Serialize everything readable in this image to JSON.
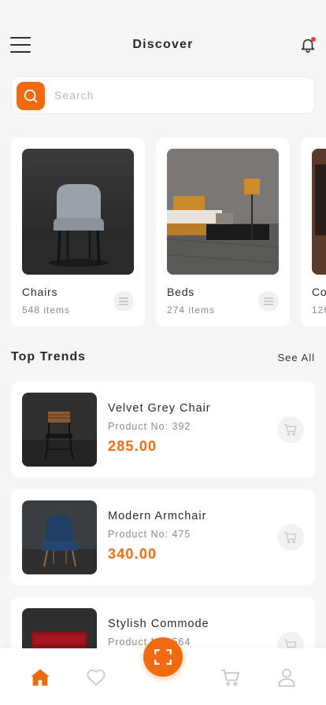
{
  "header": {
    "title": "Discover"
  },
  "search": {
    "placeholder": "Search",
    "value": ""
  },
  "categories": [
    {
      "name": "Chairs",
      "count": "548 items"
    },
    {
      "name": "Beds",
      "count": "274 items"
    },
    {
      "name": "Co",
      "count": "126"
    }
  ],
  "trends": {
    "title": "Top Trends",
    "see_all": "See All"
  },
  "products": [
    {
      "name": "Velvet Grey Chair",
      "number": "Product No: 392",
      "price": "285.00"
    },
    {
      "name": "Modern Armchair",
      "number": "Product No: 475",
      "price": "340.00"
    },
    {
      "name": "Stylish Commode",
      "number": "Product No: 564",
      "price": ""
    }
  ],
  "colors": {
    "accent": "#f06a0f",
    "background": "#f6f6f6",
    "card": "#ffffff",
    "price": "#ef6c11",
    "notification_dot": "#ef3b2d"
  },
  "icons": [
    "menu-icon",
    "bell-icon",
    "search-icon",
    "list-icon",
    "cart-icon",
    "home-icon",
    "heart-icon",
    "scan-icon",
    "user-icon"
  ],
  "nav": {
    "active": "home"
  }
}
